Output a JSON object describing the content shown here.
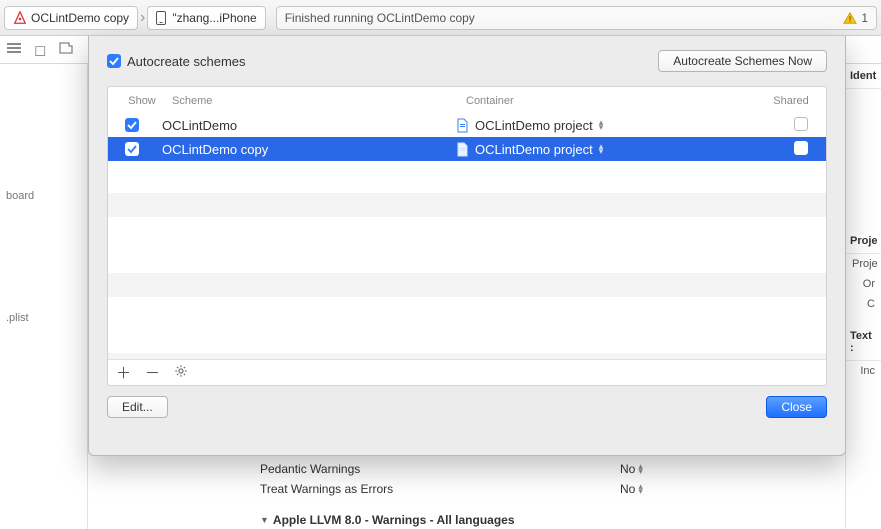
{
  "toolbar": {
    "target_name": "OCLintDemo copy",
    "device_name": "\"zhang...iPhone",
    "status_text": "Finished running OCLintDemo copy",
    "warning_count": "1"
  },
  "sidebar": {
    "item1": "board",
    "item2": ".plist"
  },
  "right": {
    "ident": "Ident",
    "proj_label": "Proje",
    "proj_sub1": "Proje",
    "proj_sub2": "Or",
    "proj_sub3": "C",
    "text_label": "Text :",
    "text_sub1": "Inc"
  },
  "dialog": {
    "autocreate_label": "Autocreate schemes",
    "autocreate_now": "Autocreate Schemes Now",
    "col_show": "Show",
    "col_scheme": "Scheme",
    "col_container": "Container",
    "col_shared": "Shared",
    "edit_label": "Edit...",
    "close_label": "Close",
    "rows": [
      {
        "scheme": "OCLintDemo",
        "container": "OCLintDemo project",
        "show": true,
        "shared": false
      },
      {
        "scheme": "OCLintDemo copy",
        "container": "OCLintDemo project",
        "show": true,
        "shared": false
      }
    ]
  },
  "settings": {
    "row1_k": "Pedantic Warnings",
    "row1_v": "No",
    "row2_k": "Treat Warnings as Errors",
    "row2_v": "No",
    "section": "Apple LLVM 8.0 - Warnings - All languages"
  }
}
